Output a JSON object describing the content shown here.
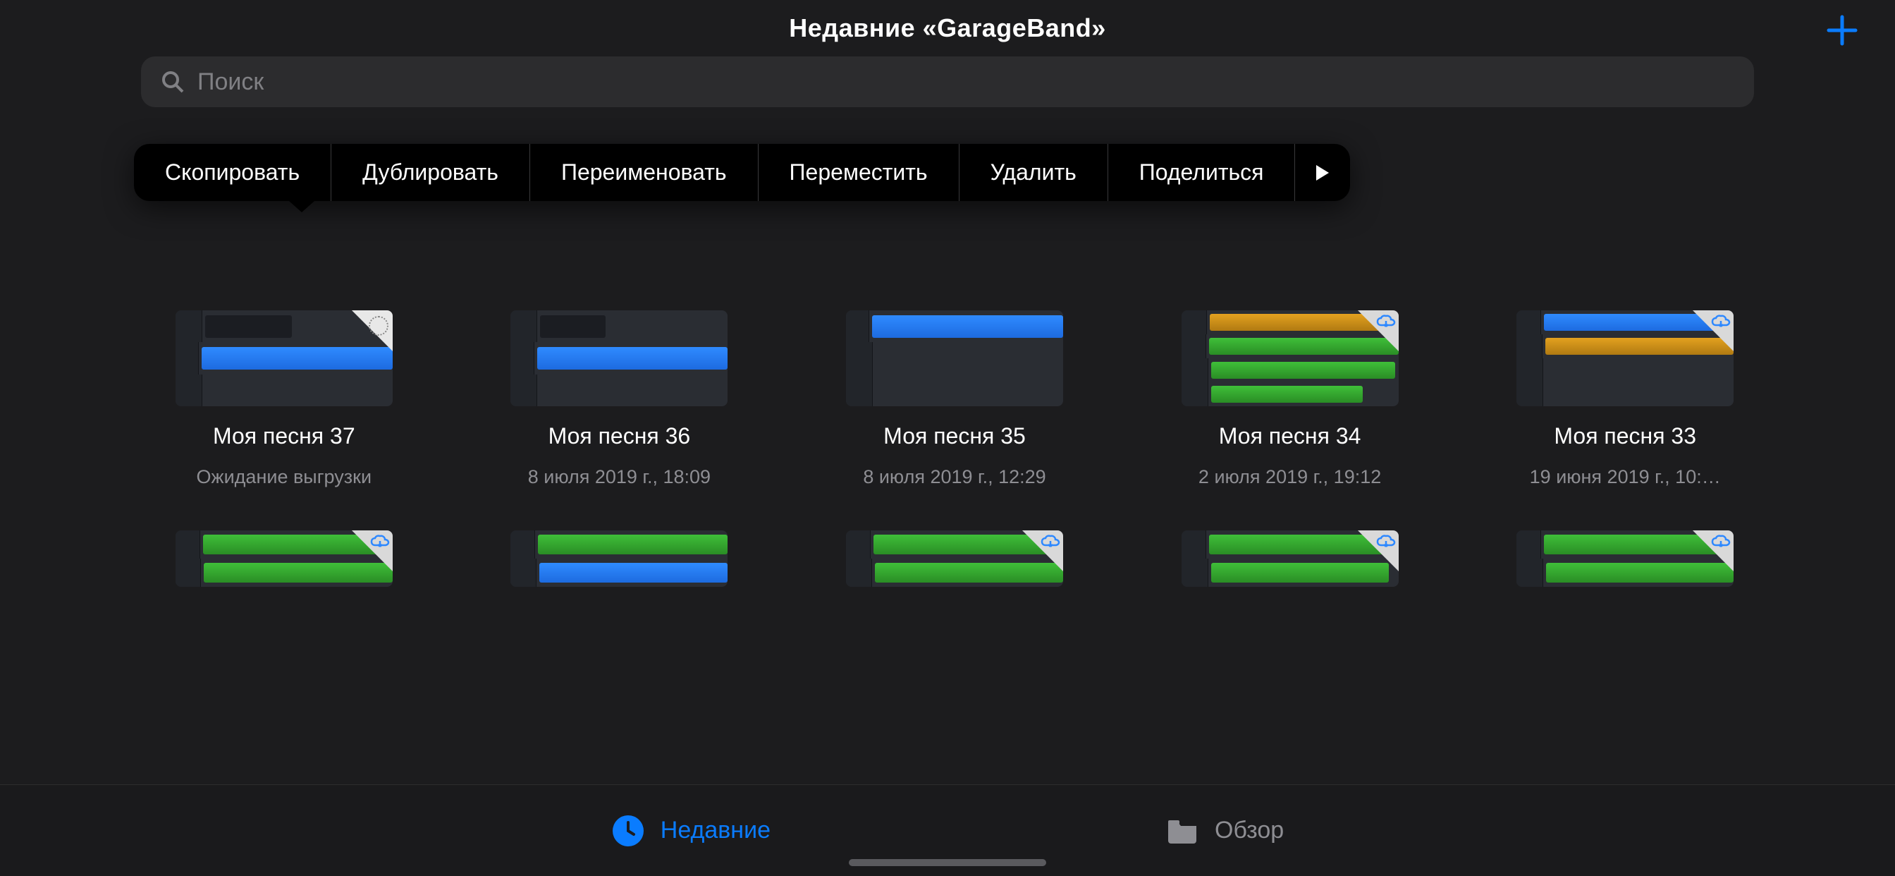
{
  "header": {
    "title": "Недавние «GarageBand»",
    "add_button_name": "add"
  },
  "search": {
    "placeholder": "Поиск",
    "value": ""
  },
  "context_menu": {
    "items": [
      {
        "label": "Скопировать"
      },
      {
        "label": "Дублировать"
      },
      {
        "label": "Переименовать"
      },
      {
        "label": "Переместить"
      },
      {
        "label": "Удалить"
      },
      {
        "label": "Поделиться"
      }
    ],
    "more_name": "more"
  },
  "songs_row1": [
    {
      "title": "Моя песня 37",
      "subtitle": "Ожидание выгрузки",
      "thumb": "blue1",
      "badge": "selected"
    },
    {
      "title": "Моя песня 36",
      "subtitle": "8 июля 2019 г., 18:09",
      "thumb": "blue1",
      "badge": "none"
    },
    {
      "title": "Моя песня 35",
      "subtitle": "8 июля 2019 г., 12:29",
      "thumb": "blue1",
      "badge": "none"
    },
    {
      "title": "Моя песня 34",
      "subtitle": "2 июля 2019 г., 19:12",
      "thumb": "multi1",
      "badge": "cloud"
    },
    {
      "title": "Моя песня 33",
      "subtitle": "19 июня 2019 г., 10:…",
      "thumb": "multi2",
      "badge": "cloud"
    }
  ],
  "songs_row2": [
    {
      "thumb": "green1",
      "badge": "cloud"
    },
    {
      "thumb": "green2",
      "badge": "none"
    },
    {
      "thumb": "green1",
      "badge": "cloud"
    },
    {
      "thumb": "green1",
      "badge": "cloud"
    },
    {
      "thumb": "green1",
      "badge": "cloud"
    }
  ],
  "tabbar": {
    "recent_label": "Недавние",
    "browse_label": "Обзор",
    "active": "recent"
  },
  "colors": {
    "accent": "#0a7cff",
    "background": "#1c1c1e",
    "secondary_text": "#8e8e93"
  }
}
